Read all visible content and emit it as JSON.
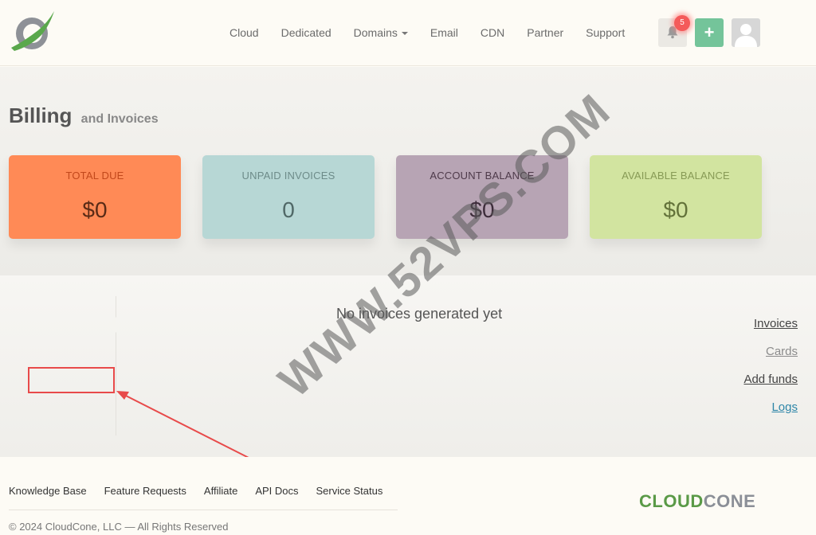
{
  "nav": {
    "items": [
      "Cloud",
      "Dedicated",
      "Domains",
      "Email",
      "CDN",
      "Partner",
      "Support"
    ],
    "notification_count": "5",
    "add_label": "+"
  },
  "billing": {
    "title": "Billing",
    "subtitle": "and Invoices",
    "cards": [
      {
        "caption": "TOTAL DUE",
        "value": "$0"
      },
      {
        "caption": "UNPAID INVOICES",
        "value": "0"
      },
      {
        "caption": "ACCOUNT BALANCE",
        "value": "$0"
      },
      {
        "caption": "AVAILABLE BALANCE",
        "value": "$0"
      }
    ]
  },
  "sidebar": {
    "items": [
      {
        "label": "Invoices"
      },
      {
        "label": "Cards"
      },
      {
        "label": "Add funds"
      },
      {
        "label": "Logs"
      }
    ]
  },
  "main": {
    "empty_message": "No invoices generated yet"
  },
  "watermark": "WWW.52VPS.COM",
  "footer": {
    "links": [
      "Knowledge Base",
      "Feature Requests",
      "Affiliate",
      "API Docs",
      "Service Status"
    ],
    "copyright": "© 2024 CloudCone, LLC — All Rights Reserved",
    "brand_part1": "CLOUD",
    "brand_part2": "CONE"
  },
  "colors": {
    "total_due": "#ff8a56",
    "unpaid_invoices": "#b7d7d5",
    "account_balance": "#b7a4b4",
    "available_balance": "#d2e4a0",
    "accent_green": "#74c49a",
    "link_blue": "#2e86a8",
    "highlight_red": "#e84a4a"
  }
}
